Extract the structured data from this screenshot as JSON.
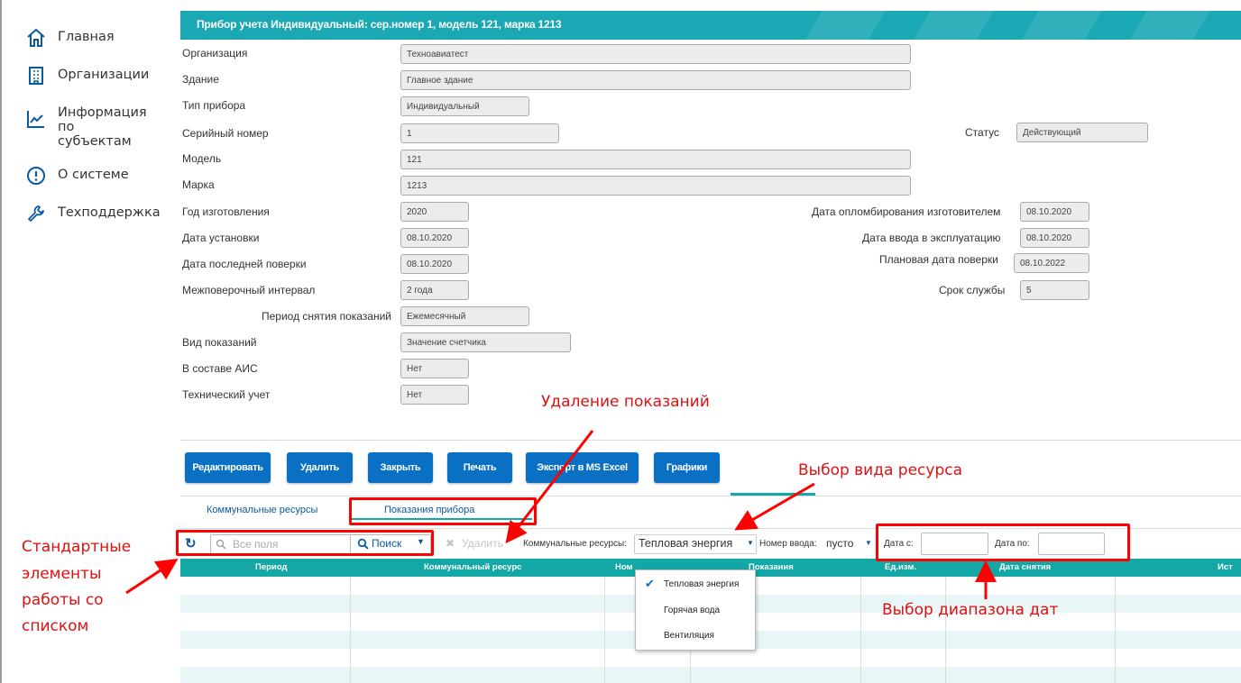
{
  "sidebar": {
    "items": [
      {
        "label": "Главная",
        "icon": "home-icon"
      },
      {
        "label": "Организации",
        "icon": "building-icon"
      },
      {
        "label": "Информация по субъектам",
        "icon": "chart-line-icon"
      },
      {
        "label": "О системе",
        "icon": "info-icon"
      },
      {
        "label": "Техподдержка",
        "icon": "wrench-icon"
      }
    ]
  },
  "header": {
    "title": "Прибор учета Индивидуальный: сер.номер 1, модель 121, марка 1213",
    "color": "#1ba8b5"
  },
  "form": {
    "organization": {
      "label": "Организация",
      "value": "Техноавиатест"
    },
    "building": {
      "label": "Здание",
      "value": "Главное здание"
    },
    "device_type": {
      "label": "Тип прибора",
      "value": "Индивидуальный"
    },
    "serial": {
      "label": "Серийный номер",
      "value": "1"
    },
    "status": {
      "label": "Статус",
      "value": "Действующий"
    },
    "model": {
      "label": "Модель",
      "value": "121"
    },
    "brand": {
      "label": "Марка",
      "value": "1213"
    },
    "year": {
      "label": "Год изготовления",
      "value": "2020"
    },
    "seal_date": {
      "label": "Дата опломбирования изготовителем",
      "value": "08.10.2020"
    },
    "install_date": {
      "label": "Дата установки",
      "value": "08.10.2020"
    },
    "commission_date": {
      "label": "Дата ввода в эксплуатацию",
      "value": "08.10.2020"
    },
    "last_check": {
      "label": "Дата последней поверки",
      "value": "08.10.2020"
    },
    "planned_check": {
      "label": "Плановая дата поверки",
      "value": "08.10.2022"
    },
    "interval": {
      "label": "Межповерочный интервал",
      "value": "2 года"
    },
    "service_life": {
      "label": "Срок службы",
      "value": "5"
    },
    "period": {
      "label": "Период снятия показаний",
      "value": "Ежемесячный"
    },
    "reading_type": {
      "label": "Вид показаний",
      "value": "Значение счетчика"
    },
    "ais": {
      "label": "В составе АИС",
      "value": "Нет"
    },
    "tech": {
      "label": "Технический учет",
      "value": "Нет"
    }
  },
  "buttons": {
    "edit": "Редактировать",
    "delete": "Удалить",
    "close": "Закрыть",
    "print": "Печать",
    "export": "Экспорт в MS Excel",
    "charts": "Графики",
    "color": "#0a70c4"
  },
  "tabs": {
    "resources": "Коммунальные ресурсы",
    "readings": "Показания прибора",
    "active": "readings"
  },
  "toolbar": {
    "search_placeholder": "Все поля",
    "search_button": "Поиск",
    "delete": "Удалить",
    "resource_label": "Коммунальные ресурсы:",
    "resource_value": "Тепловая энергия",
    "input_label": "Номер ввода:",
    "input_value": "пусто",
    "date_from": "Дата с:",
    "date_to": "Дата по:"
  },
  "table": {
    "columns": [
      "Период",
      "Коммунальный ресурс",
      "Ном",
      "Показания",
      "Ед.изм.",
      "Дата снятия",
      "Ист"
    ],
    "header_color": "#13a8a5"
  },
  "dropdown": {
    "options": [
      "Тепловая энергия",
      "Горячая вода",
      "Вентиляция"
    ],
    "selected": "Тепловая энергия"
  },
  "annotations": {
    "delete_readings": "Удаление показаний",
    "resource_choice": "Выбор вида ресурса",
    "date_range": "Выбор диапазона дат",
    "standard_1": "Стандартные",
    "standard_2": "элементы",
    "standard_3": "работы со",
    "standard_4": "списком",
    "color": "#e01010"
  }
}
